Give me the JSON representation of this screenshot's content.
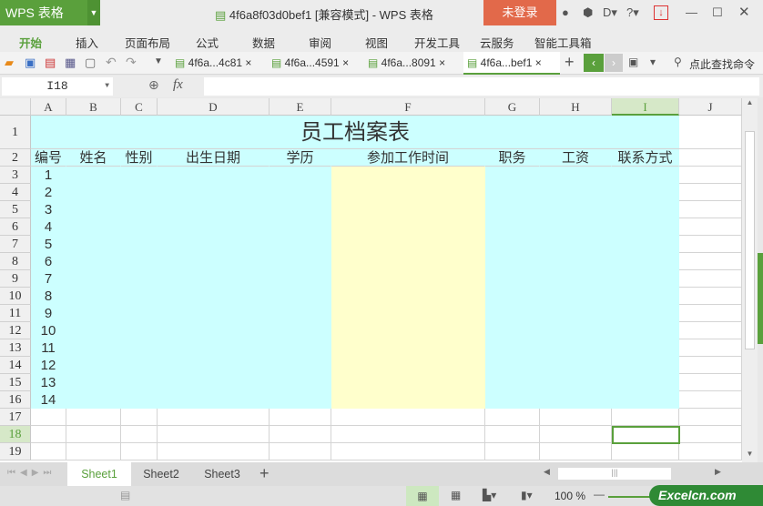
{
  "app": {
    "name": "WPS 表格",
    "doc_title": "4f6a8f03d0bef1 [兼容模式] - WPS 表格",
    "login": "未登录"
  },
  "ribbon_tabs": [
    "开始",
    "插入",
    "页面布局",
    "公式",
    "数据",
    "审阅",
    "视图",
    "开发工具",
    "云服务",
    "智能工具箱"
  ],
  "doc_tabs": [
    "4f6a...4c81",
    "4f6a...4591",
    "4f6a...8091",
    "4f6a...bef1"
  ],
  "search_cmd": "点此查找命令",
  "formula": {
    "name_box": "I18",
    "fx": "fx",
    "value": ""
  },
  "columns": [
    "A",
    "B",
    "C",
    "D",
    "E",
    "F",
    "G",
    "H",
    "I",
    "J"
  ],
  "rows": [
    "1",
    "2",
    "3",
    "4",
    "5",
    "6",
    "7",
    "8",
    "9",
    "10",
    "11",
    "12",
    "13",
    "14",
    "15",
    "16",
    "17",
    "18",
    "19"
  ],
  "sheet": {
    "title": "员工档案表",
    "headers": [
      "编号",
      "姓名",
      "性别",
      "出生日期",
      "学历",
      "参加工作时间",
      "职务",
      "工资",
      "联系方式"
    ],
    "ids": [
      "1",
      "2",
      "3",
      "4",
      "5",
      "6",
      "7",
      "8",
      "9",
      "10",
      "11",
      "12",
      "13",
      "14"
    ]
  },
  "sheet_tabs": [
    "Sheet1",
    "Sheet2",
    "Sheet3"
  ],
  "zoom": "100 %",
  "watermark": "Excelcn.com",
  "colors": {
    "accent": "#5aa03c",
    "cyan": "#ccffff",
    "yellow": "#ffffcc",
    "login": "#e2694a"
  }
}
